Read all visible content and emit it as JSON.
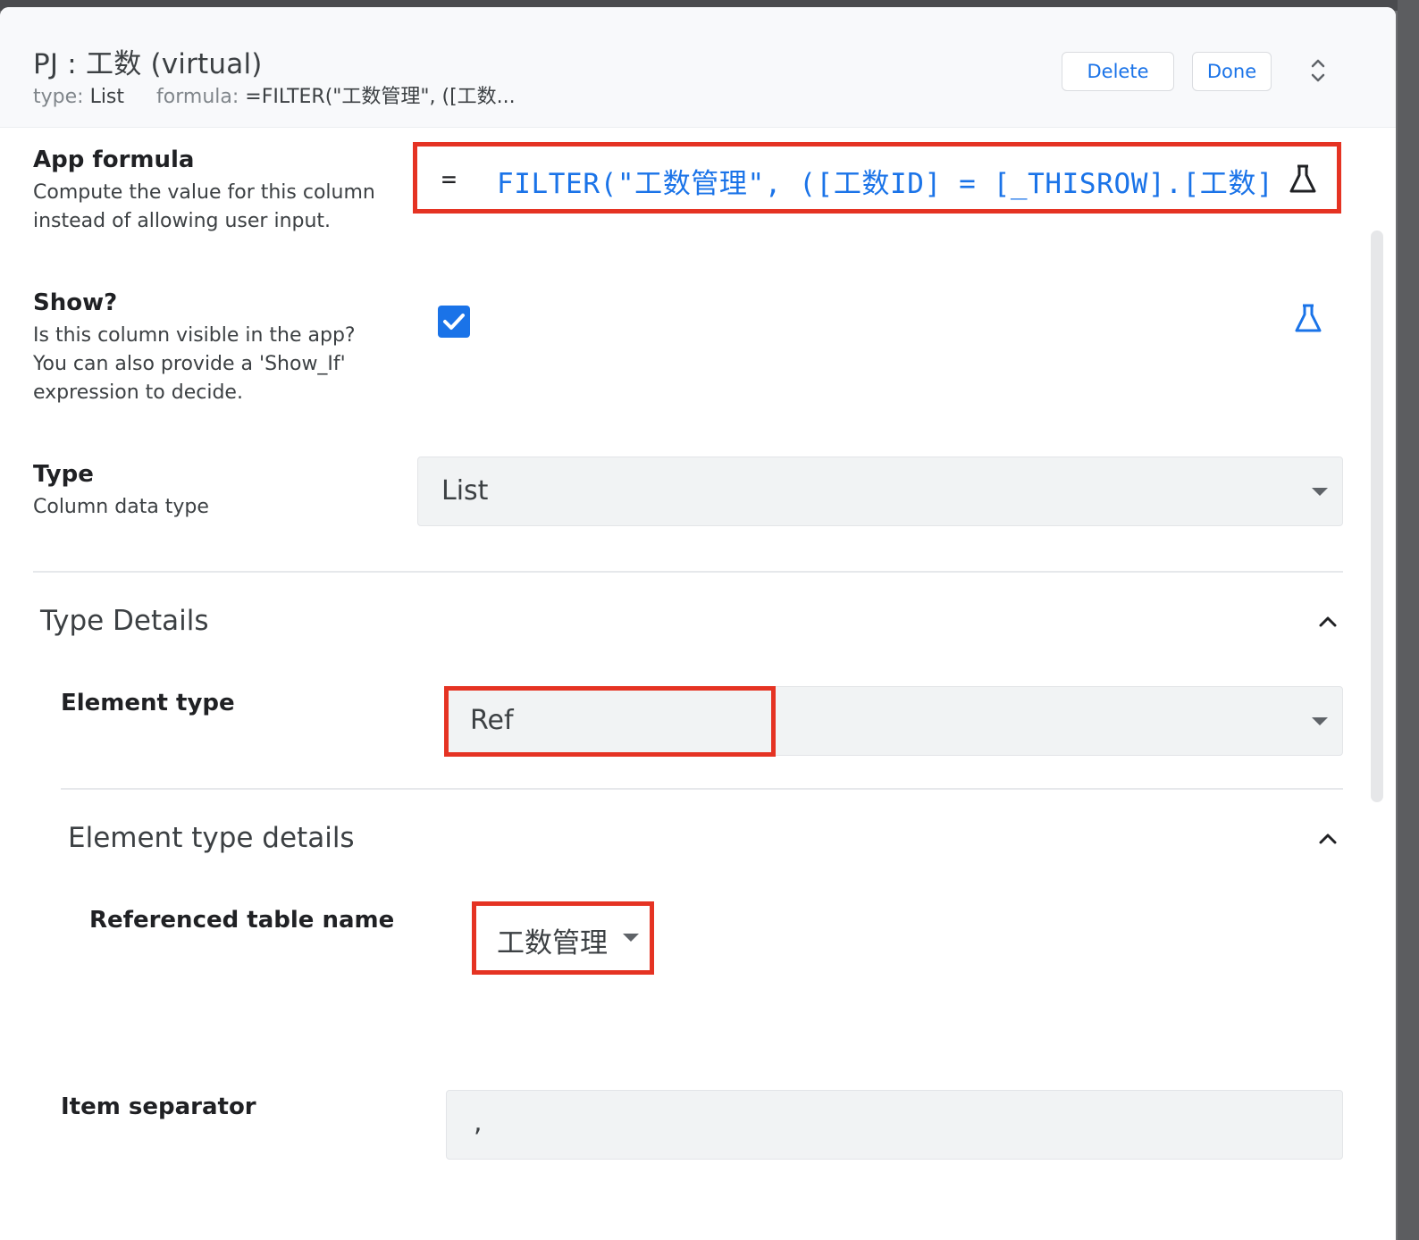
{
  "header": {
    "title": "PJ : 工数 (virtual)",
    "type_label": "type:",
    "type_value": "List",
    "formula_label": "formula:",
    "formula_value": "=FILTER(\"工数管理\", ([工数...",
    "delete_label": "Delete",
    "done_label": "Done"
  },
  "app_formula": {
    "title": "App formula",
    "description_line1": "Compute the value for this column",
    "description_line2": "instead of allowing user input.",
    "equals": "=",
    "expression": "FILTER(\"工数管理\", ([工数ID] = [_THISROW].[工数]"
  },
  "show": {
    "title": "Show?",
    "description_line1": "Is this column visible in the app?",
    "description_line2": "You can also provide a 'Show_If'",
    "description_line3": "expression to decide.",
    "checked": true
  },
  "type": {
    "title": "Type",
    "description": "Column data type",
    "value": "List"
  },
  "type_details": {
    "title": "Type Details",
    "element_type_label": "Element type",
    "element_type_value": "Ref",
    "element_type_details_title": "Element type details",
    "referenced_table_label": "Referenced table name",
    "referenced_table_value": "工数管理",
    "item_separator_label": "Item separator",
    "item_separator_value": ","
  },
  "colors": {
    "accent": "#1a73e8",
    "highlight": "#e53323",
    "field_bg": "#f1f3f4"
  },
  "icons": [
    "expand-collapse-icon",
    "flask-icon",
    "check-icon",
    "chevron-up-icon",
    "dropdown-caret-icon"
  ]
}
